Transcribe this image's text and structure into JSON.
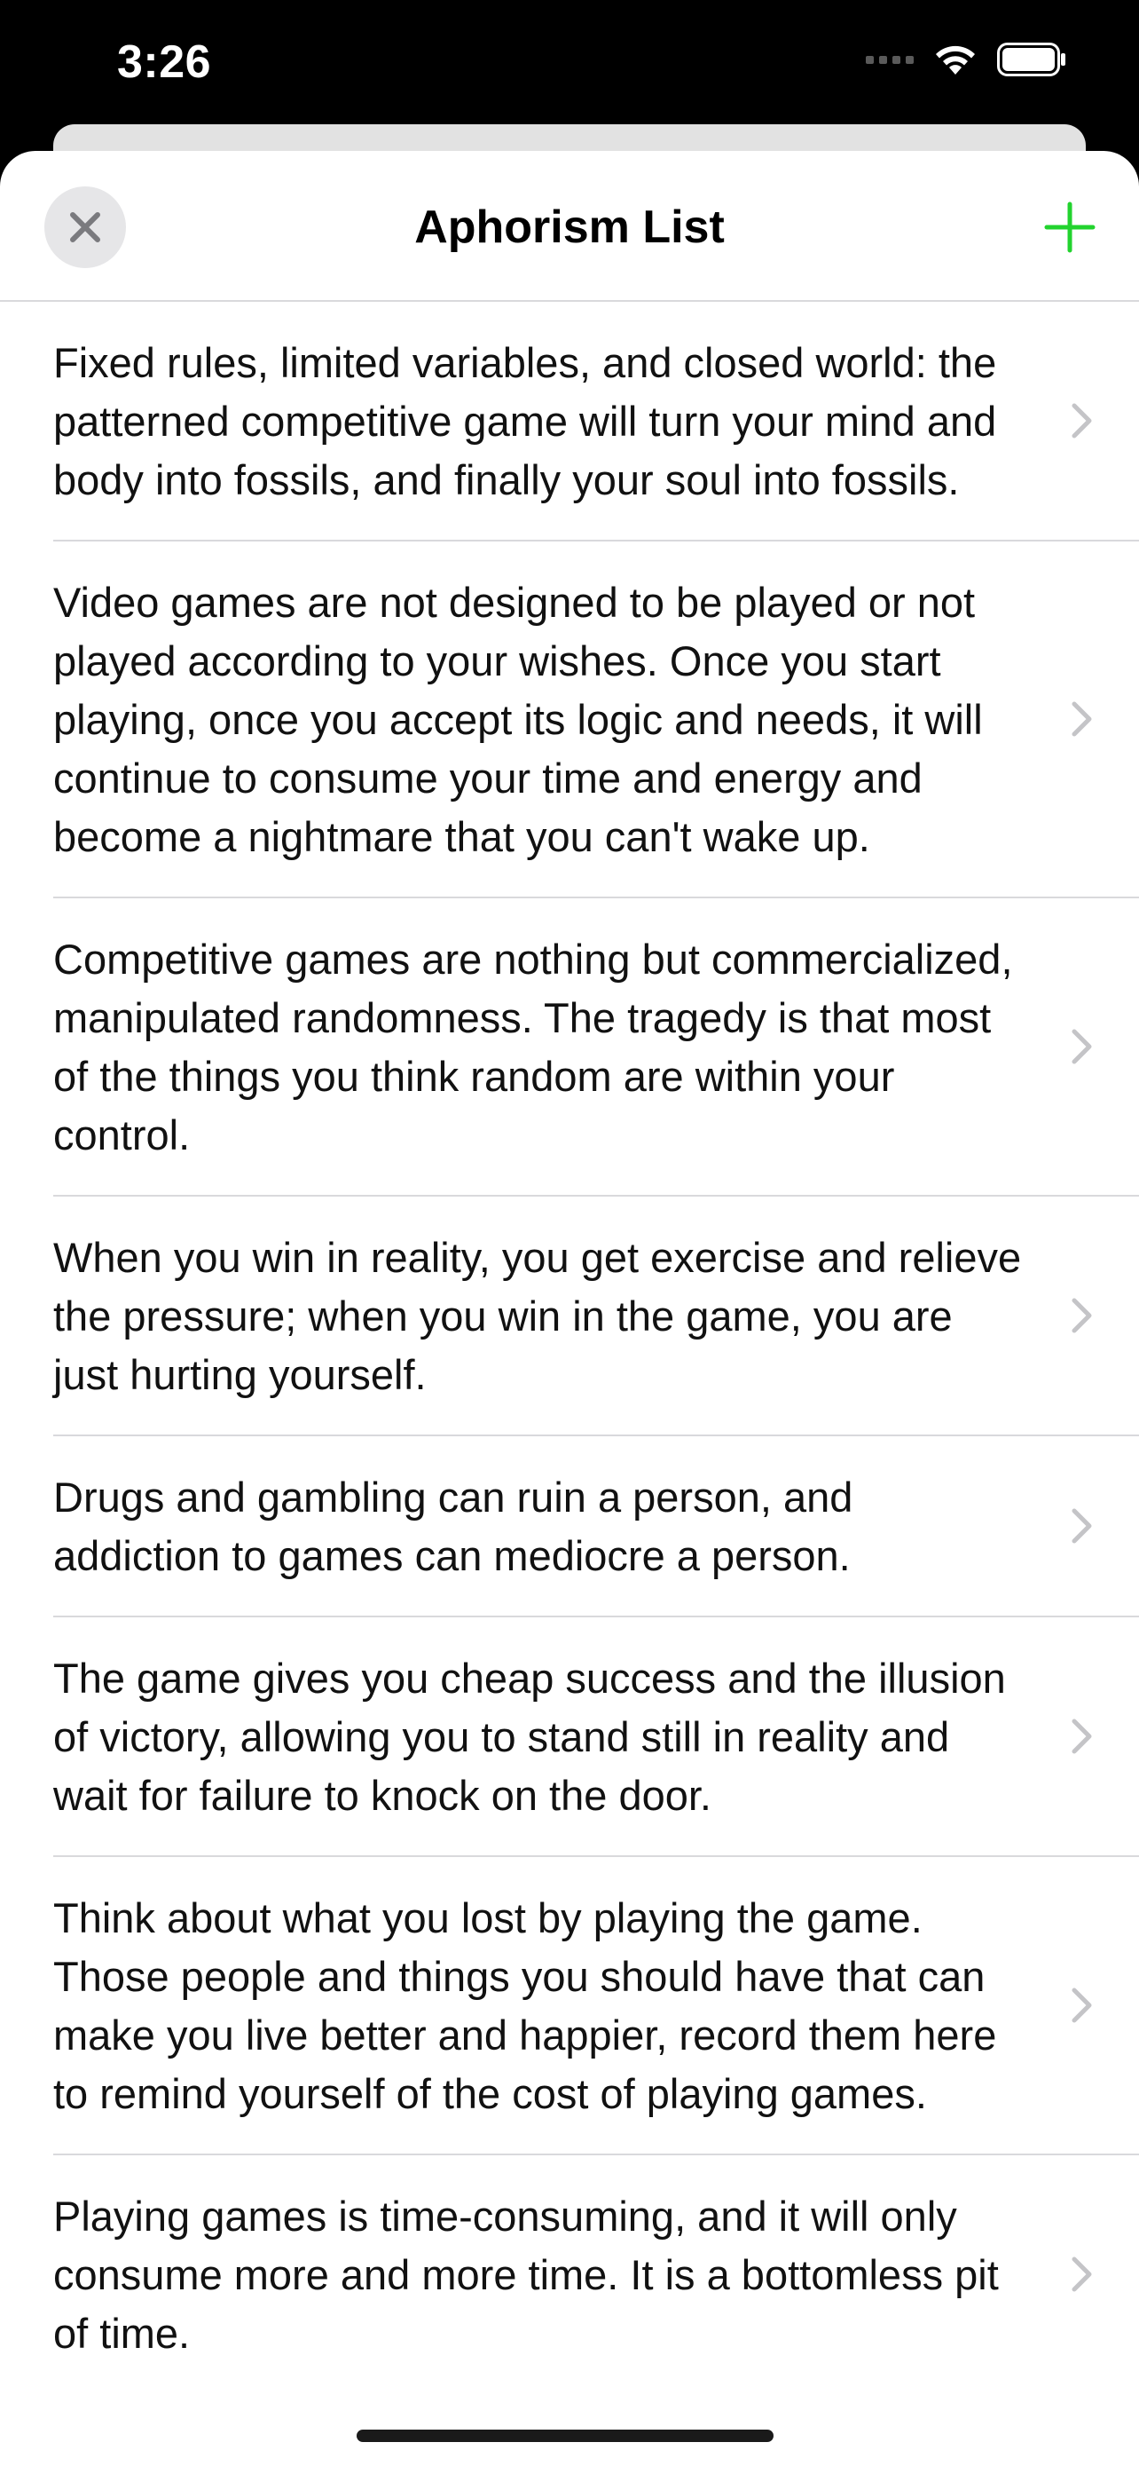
{
  "status_bar": {
    "time": "3:26"
  },
  "nav": {
    "title": "Aphorism List",
    "close_icon": "close-icon",
    "add_icon": "plus-icon"
  },
  "colors": {
    "accent": "#22d32e",
    "close_bg": "#e6e6e8",
    "chevron": "#c4c4c7"
  },
  "aphorisms": [
    {
      "text": "Fixed rules, limited variables, and closed world: the patterned competitive game will turn your mind and body into fossils, and finally your soul into fossils."
    },
    {
      "text": "Video games are not designed to be played or not played according to your wishes. Once you start playing, once you accept its logic and needs, it will continue to consume your time and energy and become a nightmare that you can't wake up."
    },
    {
      "text": "Competitive games are nothing but commercialized, manipulated randomness. The tragedy is that most of the things you think random are within your control."
    },
    {
      "text": "When you win in reality, you get exercise and relieve the pressure; when you win in the game, you are just hurting yourself."
    },
    {
      "text": "Drugs and gambling can ruin a person, and addiction to games can mediocre a person."
    },
    {
      "text": "The game gives you cheap success and the illusion of victory, allowing you to stand still in reality and wait for failure to knock on the door."
    },
    {
      "text": "Think about what you lost by playing the game. Those people and things you should have that can make you live better and happier, record them here to remind yourself of the cost of playing games."
    },
    {
      "text": "Playing games is time-consuming, and it will only consume more and more time. It is a bottomless pit of time."
    }
  ]
}
